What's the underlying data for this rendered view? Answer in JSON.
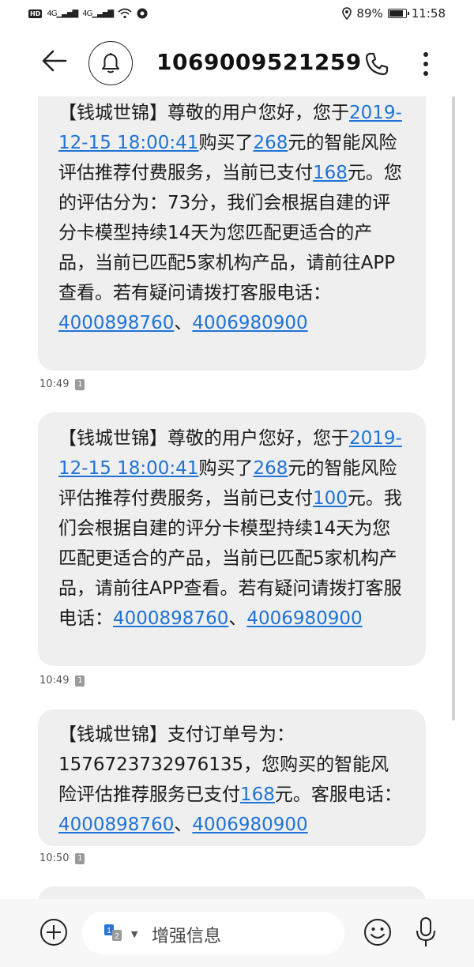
{
  "status_bar": {
    "left_badges": [
      "HD",
      "4G",
      "4G"
    ],
    "battery_percent": "89%",
    "battery_level": 0.89,
    "time": "11:58"
  },
  "header": {
    "title": "1069009521259"
  },
  "messages": [
    {
      "segments": [
        {
          "t": "【钱城世锦】尊敬的用户您好，您于"
        },
        {
          "t": "2019-12-15 18:00:41",
          "link": true
        },
        {
          "t": "购买了"
        },
        {
          "t": "268",
          "link": true
        },
        {
          "t": "元的智能风险评估推荐付费服务，当前已支付"
        },
        {
          "t": "168",
          "link": true
        },
        {
          "t": "元。您的评估分为：73分，我们会根据自建的评分卡模型持续14天为您匹配更适合的产品，当前已匹配5家机构产品，请前往APP查看。若有疑问请拨打客服电话："
        },
        {
          "t": "4000898760",
          "link": true
        },
        {
          "t": "、"
        },
        {
          "t": "4006980900",
          "link": true
        }
      ],
      "time": "10:49",
      "sim": "1"
    },
    {
      "segments": [
        {
          "t": "【钱城世锦】尊敬的用户您好，您于"
        },
        {
          "t": "2019-12-15 18:00:41",
          "link": true
        },
        {
          "t": "购买了"
        },
        {
          "t": "268",
          "link": true
        },
        {
          "t": "元的智能风险评估推荐付费服务，当前已支付"
        },
        {
          "t": "100",
          "link": true
        },
        {
          "t": "元。我们会根据自建的评分卡模型持续14天为您匹配更适合的产品，当前已匹配5家机构产品，请前往APP查看。若有疑问请拨打客服电话："
        },
        {
          "t": "4000898760",
          "link": true
        },
        {
          "t": "、"
        },
        {
          "t": "4006980900",
          "link": true
        }
      ],
      "time": "10:49",
      "sim": "1"
    },
    {
      "segments": [
        {
          "t": "【钱城世锦】支付订单号为：1576723732976135，您购买的智能风险评估推荐服务已支付"
        },
        {
          "t": "168",
          "link": true
        },
        {
          "t": "元。客服电话："
        },
        {
          "t": "4000898760",
          "link": true
        },
        {
          "t": "、"
        },
        {
          "t": "4006980900",
          "link": true
        }
      ],
      "time": "10:50",
      "sim": "1"
    }
  ],
  "input_bar": {
    "sim_selector": "1 2",
    "placeholder": "增强信息"
  },
  "icons": {
    "back": "back-arrow-icon",
    "bell": "bell-icon",
    "phone": "phone-icon",
    "more": "more-vertical-icon",
    "add": "add-circle-icon",
    "emoji": "emoji-icon",
    "mic": "microphone-icon"
  },
  "colors": {
    "link": "#1f73d6",
    "bubble": "#efefef",
    "sim_badge": "#9a9a9a",
    "sim_selector_blue": "#2a73d9"
  }
}
